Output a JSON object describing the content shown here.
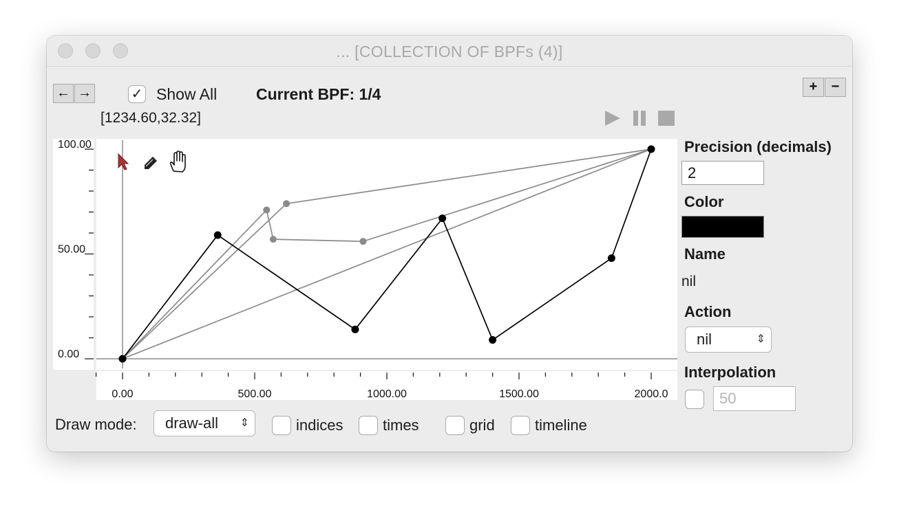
{
  "window": {
    "title": "... [COLLECTION OF BPFs (4)]"
  },
  "toolbar": {
    "prev_label": "←",
    "next_label": "→",
    "show_all_label": "Show All",
    "show_all_checked": true,
    "current_bpf_label": "Current BPF: 1/4",
    "coordinates": "[1234.60,32.32]",
    "add_label": "+",
    "remove_label": "−"
  },
  "transport": {
    "play_icon": "play-icon",
    "pause_icon": "pause-icon",
    "stop_icon": "stop-icon"
  },
  "tools": {
    "selected": "arrow",
    "items": [
      "arrow-tool-icon",
      "pencil-tool-icon",
      "hand-tool-icon"
    ]
  },
  "y_axis": {
    "labels": [
      {
        "value": 100,
        "text": "100.00"
      },
      {
        "value": 50,
        "text": "50.00"
      },
      {
        "value": 0,
        "text": "0.00"
      }
    ],
    "ylim": [
      0,
      100
    ]
  },
  "x_axis": {
    "labels": [
      {
        "value": 0,
        "text": "0.00"
      },
      {
        "value": 500,
        "text": "500.00"
      },
      {
        "value": 1000,
        "text": "1000.00"
      },
      {
        "value": 1500,
        "text": "1500.00"
      },
      {
        "value": 2000,
        "text": "2000.0"
      }
    ],
    "xlim": [
      -100,
      2100
    ]
  },
  "chart_data": {
    "type": "line",
    "xlim": [
      -100,
      2100
    ],
    "ylim": [
      -5,
      105
    ],
    "grid": false,
    "series": [
      {
        "color": "#000000",
        "points": [
          [
            0,
            0
          ],
          [
            360,
            59
          ],
          [
            880,
            14
          ],
          [
            1210,
            67
          ],
          [
            1400,
            9
          ],
          [
            1850,
            48
          ],
          [
            2000,
            100
          ]
        ]
      },
      {
        "color": "#8a8a8a",
        "points": [
          [
            0,
            0
          ],
          [
            545,
            71
          ],
          [
            570,
            57
          ],
          [
            910,
            56
          ],
          [
            2000,
            100
          ]
        ]
      },
      {
        "color": "#8a8a8a",
        "points": [
          [
            0,
            0
          ],
          [
            620,
            74
          ],
          [
            2000,
            100
          ]
        ]
      },
      {
        "color": "#8a8a8a",
        "points": [
          [
            0,
            0
          ],
          [
            2000,
            100
          ]
        ]
      }
    ]
  },
  "panel": {
    "precision_label": "Precision (decimals)",
    "precision_value": "2",
    "color_label": "Color",
    "color_value": "#000000",
    "name_label": "Name",
    "name_value": "nil",
    "action_label": "Action",
    "action_value": "nil",
    "interpolation_label": "Interpolation",
    "interpolation_checked": false,
    "interpolation_value": "50"
  },
  "bottom": {
    "draw_mode_label": "Draw mode:",
    "draw_mode_value": "draw-all",
    "indices_label": "indices",
    "times_label": "times",
    "grid_label": "grid",
    "timeline_label": "timeline"
  }
}
